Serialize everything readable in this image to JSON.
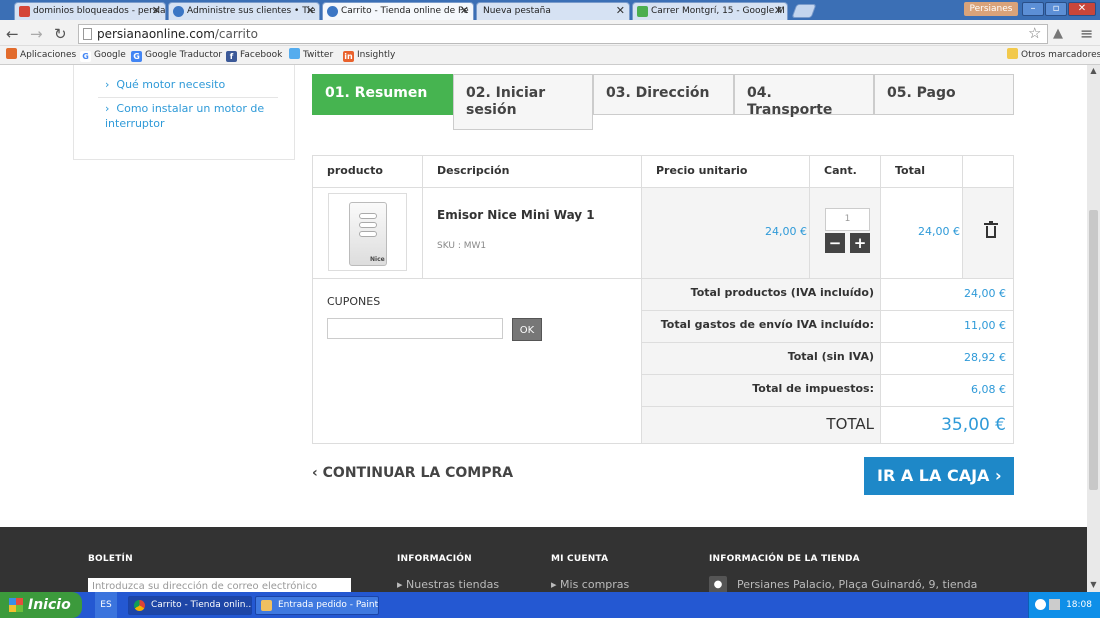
{
  "browser": {
    "tabs": [
      {
        "label": "dominios bloqueados - persia"
      },
      {
        "label": "Administre sus clientes • Tie"
      },
      {
        "label": "Carrito - Tienda online de Pe"
      },
      {
        "label": "Nueva pestaña"
      },
      {
        "label": "Carrer Montgrí, 15 - Google M"
      }
    ],
    "profile_label": "Persianes",
    "address": {
      "domain": "persianaonline.com",
      "path": "/carrito"
    },
    "bookmarks": [
      "Aplicaciones",
      "Google",
      "Google Traductor",
      "Facebook",
      "Twitter",
      "Insightly"
    ],
    "other_bookmarks": "Otros marcadores"
  },
  "sidebar": {
    "links": [
      "Qué motor necesito",
      "Como instalar un motor de interruptor"
    ]
  },
  "steps": [
    "01. Resumen",
    "02. Iniciar sesión",
    "03. Dirección",
    "04. Transporte",
    "05. Pago"
  ],
  "cart": {
    "headers": {
      "product": "producto",
      "description": "Descripción",
      "unit_price": "Precio unitario",
      "qty": "Cant.",
      "total": "Total"
    },
    "item": {
      "name": "Emisor Nice Mini Way 1",
      "sku": "SKU : MW1",
      "unit_price": "24,00 €",
      "qty": "1",
      "total": "24,00 €",
      "img_brand": "Nice"
    },
    "coupons_label": "CUPONES",
    "ok_label": "OK",
    "totals": [
      {
        "label": "Total productos (IVA incluído)",
        "value": "24,00 €"
      },
      {
        "label": "Total gastos de envío IVA incluído:",
        "value": "11,00 €"
      },
      {
        "label": "Total (sin IVA)",
        "value": "28,92 €"
      },
      {
        "label": "Total de impuestos:",
        "value": "6,08 €"
      }
    ],
    "grand_total": {
      "label": "TOTAL",
      "value": "35,00 €"
    },
    "continue_label": "CONTINUAR LA COMPRA",
    "checkout_label": "IR A LA CAJA"
  },
  "footer": {
    "headings": [
      "BOLETÍN",
      "INFORMACIÓN",
      "MI CUENTA",
      "INFORMACIÓN DE LA TIENDA"
    ],
    "newsletter_placeholder": "Introduzca su dirección de correo electrónico",
    "links": [
      "Nuestras tiendas",
      "Mis compras",
      "Persianes Palacio, Plaça Guinardó, 9, tienda"
    ]
  },
  "taskbar": {
    "start": "Inicio",
    "lang": "ES",
    "tasks": [
      "Carrito - Tienda onlin...",
      "Entrada pedido - Paint"
    ],
    "clock": "18:08"
  },
  "colors": {
    "accent": "#46b450",
    "link": "#2f9ad8",
    "checkout": "#1e88c8"
  }
}
